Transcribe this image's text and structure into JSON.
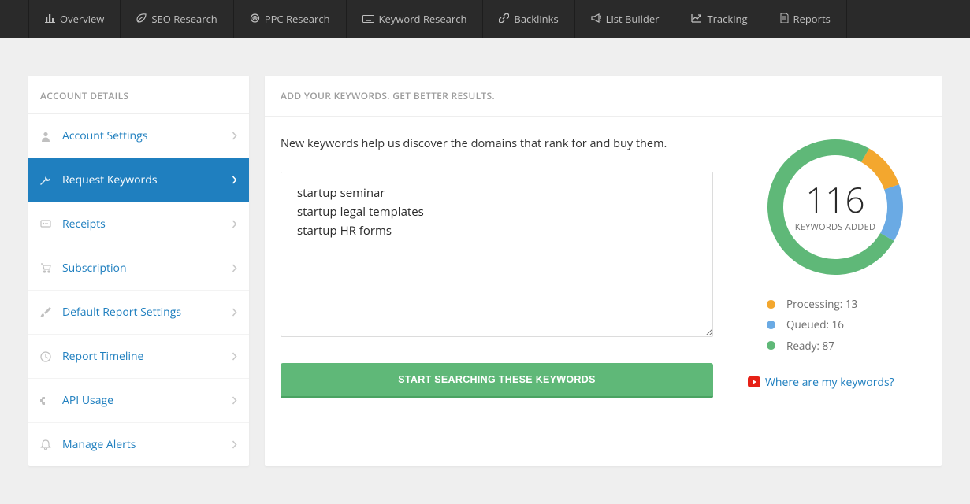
{
  "nav": [
    {
      "label": "Overview"
    },
    {
      "label": "SEO Research"
    },
    {
      "label": "PPC Research"
    },
    {
      "label": "Keyword Research"
    },
    {
      "label": "Backlinks"
    },
    {
      "label": "List Builder"
    },
    {
      "label": "Tracking"
    },
    {
      "label": "Reports"
    }
  ],
  "sidebar": {
    "header": "ACCOUNT DETAILS",
    "items": [
      {
        "label": "Account Settings"
      },
      {
        "label": "Request Keywords"
      },
      {
        "label": "Receipts"
      },
      {
        "label": "Subscription"
      },
      {
        "label": "Default Report Settings"
      },
      {
        "label": "Report Timeline"
      },
      {
        "label": "API Usage"
      },
      {
        "label": "Manage Alerts"
      }
    ],
    "activeIndex": 1
  },
  "main": {
    "header": "ADD YOUR KEYWORDS. GET BETTER RESULTS.",
    "intro": "New keywords help us discover the domains that rank for and buy them.",
    "textarea_value": "startup seminar\nstartup legal templates\nstartup HR forms",
    "button": "START SEARCHING THESE KEYWORDS"
  },
  "donut": {
    "value": "116",
    "label": "KEYWORDS ADDED"
  },
  "status": [
    {
      "color": "#f3a72e",
      "label": "Processing:",
      "value": "13"
    },
    {
      "color": "#6aaae4",
      "label": "Queued:",
      "value": "16"
    },
    {
      "color": "#5fb878",
      "label": "Ready:",
      "value": "87"
    }
  ],
  "help": {
    "text": "Where are my keywords?"
  },
  "chart_data": {
    "type": "pie",
    "title": "Keywords Added",
    "total": 116,
    "series": [
      {
        "name": "Processing",
        "value": 13,
        "color": "#f3a72e"
      },
      {
        "name": "Queued",
        "value": 16,
        "color": "#6aaae4"
      },
      {
        "name": "Ready",
        "value": 87,
        "color": "#5fb878"
      }
    ]
  },
  "nav_icons": [
    "bar-chart-icon",
    "leaf-icon",
    "target-icon",
    "keyboard-icon",
    "link-icon",
    "megaphone-icon",
    "line-chart-icon",
    "file-icon"
  ],
  "side_icons": [
    "user-icon",
    "wrench-icon",
    "receipt-icon",
    "cart-icon",
    "brush-icon",
    "clock-icon",
    "code-icon",
    "bell-icon"
  ]
}
